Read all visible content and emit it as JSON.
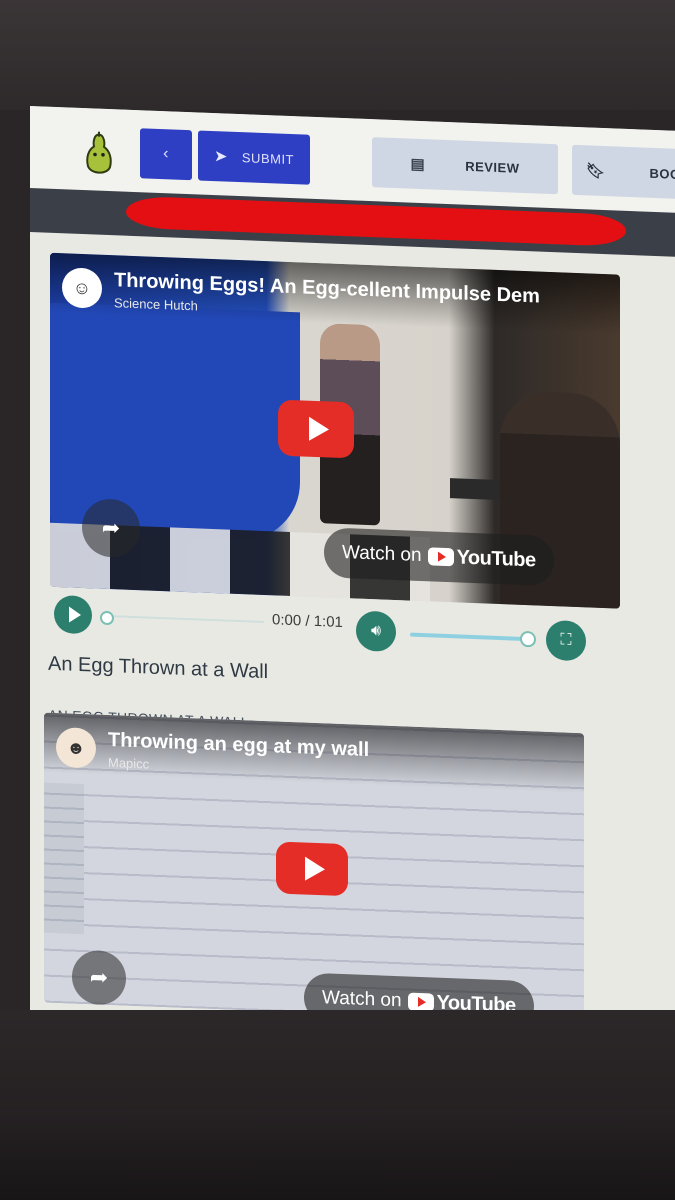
{
  "toolbar": {
    "back_label": "‹",
    "submit_label": "SUBMIT",
    "review_label": "REVIEW",
    "bookmark_label": "BOOK"
  },
  "video1": {
    "title": "Throwing Eggs! An Egg-cellent Impulse Dem",
    "channel": "Science Hutch",
    "watch_on": "Watch on",
    "youtube": "YouTube"
  },
  "player": {
    "time": "0:00 / 1:01",
    "progress": 0,
    "volume": 0.95
  },
  "caption1": "An Egg Thrown at a Wall",
  "section2_heading": "AN EGG THROWN AT A WALL",
  "video2": {
    "title": "Throwing an egg at my wall",
    "channel": "Mapicc",
    "watch_on": "Watch on",
    "youtube": "YouTube"
  },
  "colors": {
    "primary_button": "#2f3fc4",
    "secondary_button": "#cfd7e4",
    "player_accent": "#2c7f6d",
    "youtube_red": "#e52d27",
    "redaction": "#e30f12"
  },
  "icons": {
    "logo": "pear-logo-icon",
    "submit": "paper-plane-icon",
    "review": "document-icon",
    "bookmark": "bookmark-icon",
    "share": "share-arrow-icon",
    "volume": "volume-icon",
    "fullscreen": "fullscreen-icon"
  }
}
